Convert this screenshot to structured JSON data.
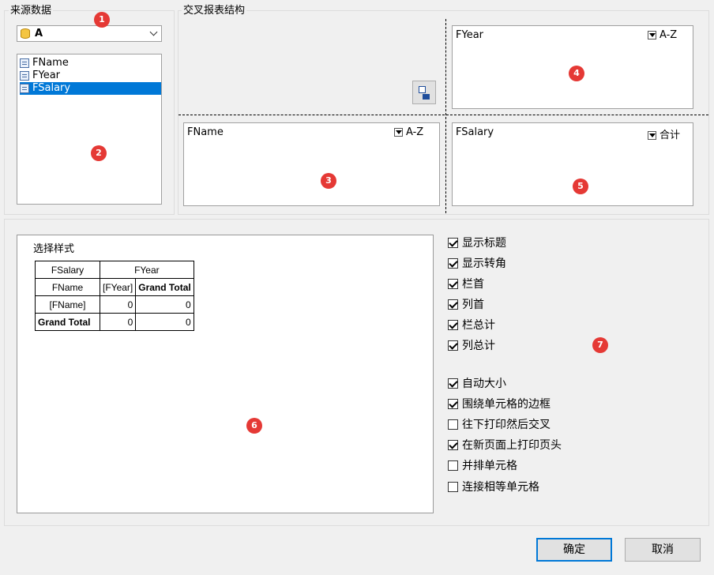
{
  "source": {
    "title": "来源数据",
    "datasource": "A",
    "fields": [
      "FName",
      "FYear",
      "FSalary"
    ],
    "selected_field": "FSalary"
  },
  "structure": {
    "title": "交叉报表结构",
    "columns": {
      "field": "FYear",
      "sort": "A-Z"
    },
    "rows": {
      "field": "FName",
      "sort": "A-Z"
    },
    "values": {
      "field": "FSalary",
      "aggregate": "合计"
    }
  },
  "badges": [
    "1",
    "2",
    "3",
    "4",
    "5",
    "6",
    "7"
  ],
  "style": {
    "title": "选择样式",
    "preview": {
      "r1": [
        "FSalary",
        "FYear"
      ],
      "r2": [
        "FName",
        "[FYear]",
        "Grand Total"
      ],
      "r3": [
        "[FName]",
        "0",
        "0"
      ],
      "r4": [
        "Grand Total",
        "0",
        "0"
      ]
    }
  },
  "options": [
    {
      "label": "显示标题",
      "checked": true
    },
    {
      "label": "显示转角",
      "checked": true
    },
    {
      "label": "栏首",
      "checked": true
    },
    {
      "label": "列首",
      "checked": true
    },
    {
      "label": "栏总计",
      "checked": true
    },
    {
      "label": "列总计",
      "checked": true
    }
  ],
  "options2": [
    {
      "label": "自动大小",
      "checked": true
    },
    {
      "label": "围绕单元格的边框",
      "checked": true
    },
    {
      "label": "往下打印然后交叉",
      "checked": false
    },
    {
      "label": "在新页面上打印页头",
      "checked": true
    },
    {
      "label": "并排单元格",
      "checked": false
    },
    {
      "label": "连接相等单元格",
      "checked": false
    }
  ],
  "buttons": {
    "ok": "确定",
    "cancel": "取消"
  }
}
